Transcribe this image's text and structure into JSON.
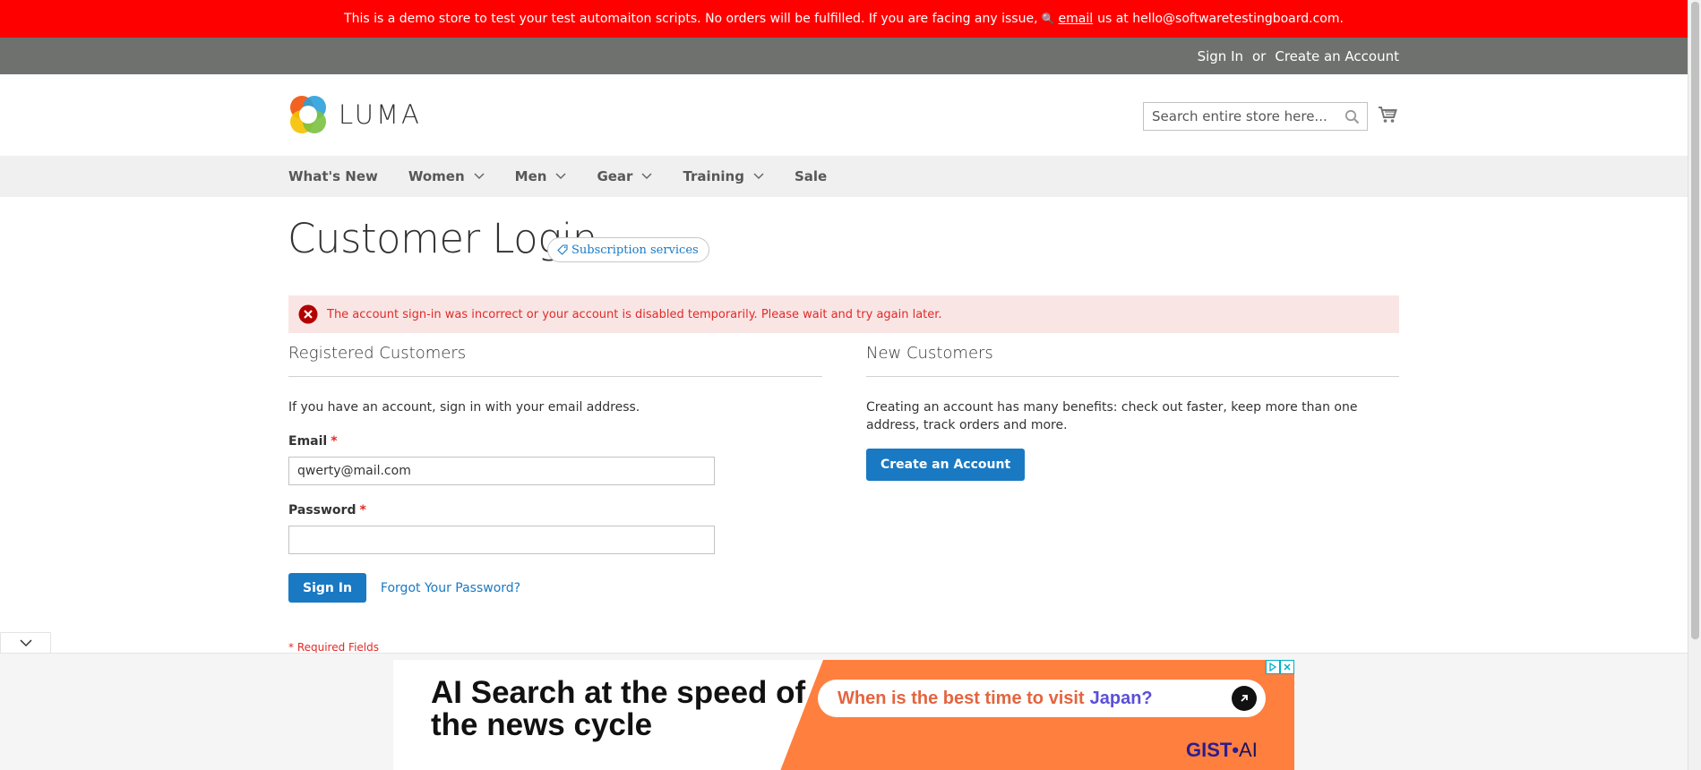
{
  "demo_banner": {
    "text_before": "This is a demo store to test your test automaiton scripts. No orders will be fulfilled. If you are facing any issue,",
    "link": "email",
    "text_after": "us at hello@softwaretestingboard.com."
  },
  "header_links": {
    "sign_in": "Sign In",
    "or": "or",
    "create_account": "Create an Account"
  },
  "logo": {
    "text": "LUMA"
  },
  "search": {
    "placeholder": "Search entire store here..."
  },
  "nav": {
    "items": [
      "What's New",
      "Women",
      "Men",
      "Gear",
      "Training",
      "Sale"
    ]
  },
  "page": {
    "title": "Customer Login",
    "badge": "Subscription services"
  },
  "error_message": "The account sign-in was incorrect or your account is disabled temporarily. Please wait and try again later.",
  "registered": {
    "title": "Registered Customers",
    "intro": "If you have an account, sign in with your email address.",
    "email_label": "Email",
    "email_value": "qwerty@mail.com",
    "password_label": "Password",
    "password_value": "",
    "required_mark": "*",
    "sign_in_button": "Sign In",
    "forgot_link": "Forgot Your Password?",
    "required_note": "* Required Fields"
  },
  "new_customers": {
    "title": "New Customers",
    "intro": "Creating an account has many benefits: check out faster, keep more than one address, track orders and more.",
    "create_button": "Create an Account"
  },
  "ad": {
    "headline": "AI Search at the speed of the news cycle",
    "query_part1": "When is the best time to visit",
    "query_part2": "Japan?",
    "brand": "GIST",
    "brand_dot": "•",
    "brand_ai": "AI"
  },
  "colors": {
    "banner_red": "#ff0000",
    "header_gray": "#6e716e",
    "primary_blue": "#1979c3",
    "error_red": "#e02b27",
    "error_bg": "#fae5e5",
    "ad_orange": "#ff7f3f"
  }
}
